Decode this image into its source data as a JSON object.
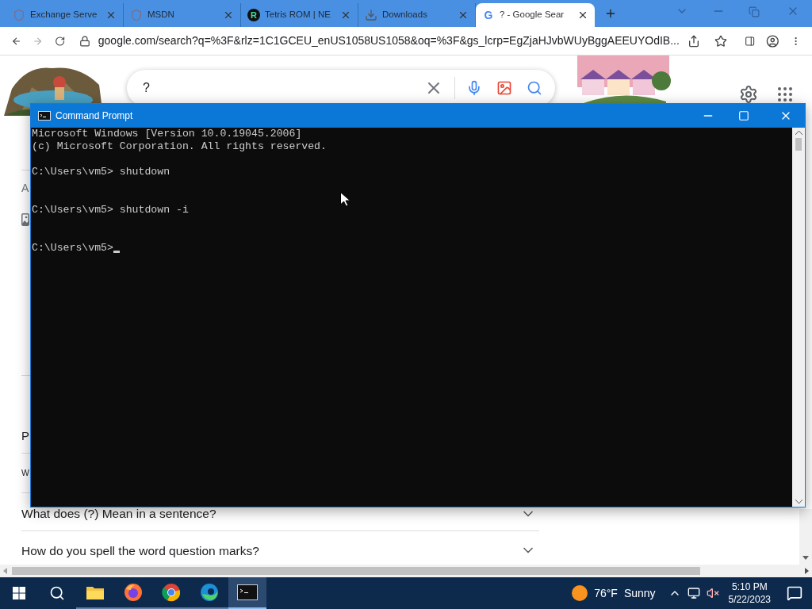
{
  "browser": {
    "tabs": [
      {
        "title": "Exchange Serve",
        "kind": "shield",
        "selected": false
      },
      {
        "title": "MSDN",
        "kind": "shield",
        "selected": false
      },
      {
        "title": "Tetris ROM | NE",
        "kind": "letter",
        "badge": "R",
        "selected": false
      },
      {
        "title": "Downloads",
        "kind": "download",
        "selected": false
      },
      {
        "title": "? - Google Sear",
        "kind": "google",
        "badge": "G",
        "selected": true
      }
    ],
    "address": "google.com/search?q=%3F&rlz=1C1GCEU_enUS1058US1058&oq=%3F&gs_lcrp=EgZjaHJvbWUyBggAEEUYOdIB...",
    "search": {
      "value": "?"
    },
    "page": {
      "partial_texts": [
        "A",
        "P",
        "W"
      ],
      "questions": [
        {
          "text": "What does (?) Mean in a sentence?"
        },
        {
          "text": "How do you spell the word question marks?"
        }
      ]
    }
  },
  "cmd": {
    "title": "Command Prompt",
    "lines": [
      {
        "kind": "output",
        "text": "Microsoft Windows [Version 10.0.19045.2006]"
      },
      {
        "kind": "output",
        "text": "(c) Microsoft Corporation. All rights reserved."
      },
      {
        "kind": "command",
        "text": "C:\\Users\\vm5> shutdown"
      },
      {
        "kind": "command",
        "text": "C:\\Users\\vm5> shutdown -i"
      },
      {
        "kind": "prompt",
        "text": "C:\\Users\\vm5>"
      }
    ]
  },
  "taskbar": {
    "apps": [
      {
        "kind": "explorer",
        "selected": false
      },
      {
        "kind": "firefox",
        "selected": false
      },
      {
        "kind": "chrome",
        "selected": false
      },
      {
        "kind": "edge",
        "selected": false
      },
      {
        "kind": "terminal",
        "selected": true
      }
    ],
    "weather": {
      "temp": "76°F",
      "condition": "Sunny"
    },
    "clock": {
      "time": "5:10 PM",
      "date": "5/22/2023"
    }
  }
}
